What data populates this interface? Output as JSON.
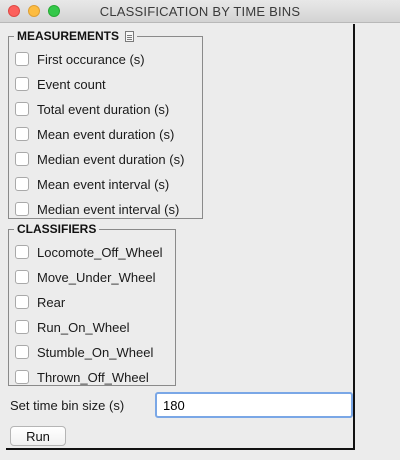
{
  "window": {
    "title": "CLASSIFICATION BY TIME BINS"
  },
  "measurements": {
    "title": "MEASUREMENTS",
    "items": [
      {
        "label": "First occurance (s)"
      },
      {
        "label": "Event count"
      },
      {
        "label": "Total event duration (s)"
      },
      {
        "label": "Mean event duration (s)"
      },
      {
        "label": "Median event duration (s)"
      },
      {
        "label": "Mean event interval (s)"
      },
      {
        "label": "Median event interval (s)"
      }
    ]
  },
  "classifiers": {
    "title": "CLASSIFIERS",
    "items": [
      {
        "label": "Locomote_Off_Wheel"
      },
      {
        "label": "Move_Under_Wheel"
      },
      {
        "label": "Rear"
      },
      {
        "label": "Run_On_Wheel"
      },
      {
        "label": "Stumble_On_Wheel"
      },
      {
        "label": "Thrown_Off_Wheel"
      }
    ]
  },
  "time_bin": {
    "label": "Set time bin size (s)",
    "value": "180"
  },
  "run_button": {
    "label": "Run"
  },
  "icons": {
    "doc": "document-icon"
  }
}
